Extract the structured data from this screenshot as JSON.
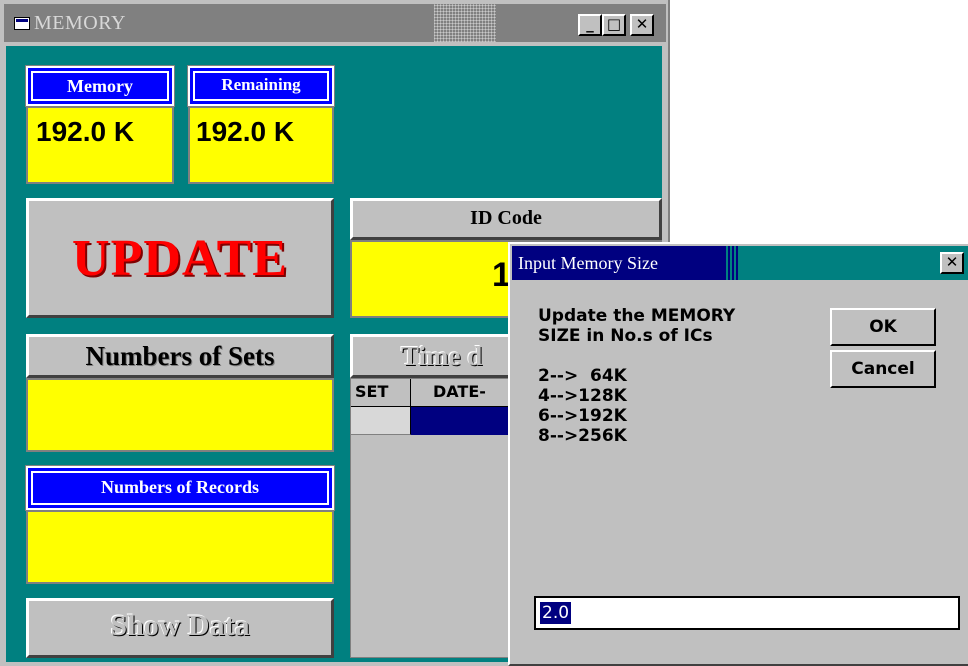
{
  "window": {
    "title": "MEMORY",
    "buttons": {
      "minimize": "_",
      "maximize": "□",
      "close": "✕"
    }
  },
  "memory": {
    "label": "Memory",
    "value": "192.0 K"
  },
  "remaining": {
    "label": "Remaining",
    "value": "192.0 K"
  },
  "update_button": "UPDATE",
  "id_code": {
    "label": "ID Code",
    "value": "1"
  },
  "sets": {
    "label": "Numbers of Sets",
    "value": ""
  },
  "time_panel": {
    "label": "Time d",
    "columns": [
      "SET",
      "DATE-"
    ]
  },
  "records": {
    "label": "Numbers of Records",
    "value": ""
  },
  "show_data_button": "Show Data",
  "dialog": {
    "title": "Input Memory Size",
    "close": "✕",
    "message": [
      "Update the MEMORY",
      "SIZE in No.s of ICs",
      "",
      "2-->  64K",
      "4-->128K",
      "6-->192K",
      "8-->256K"
    ],
    "ok_label": "OK",
    "cancel_label": "Cancel",
    "input_value": "2.0"
  },
  "colors": {
    "client_bg": "#008080",
    "value_bg": "#ffff00",
    "label_blue": "#0000ff",
    "update_text": "#ff0000",
    "dialog_title_bg": "#000080"
  }
}
